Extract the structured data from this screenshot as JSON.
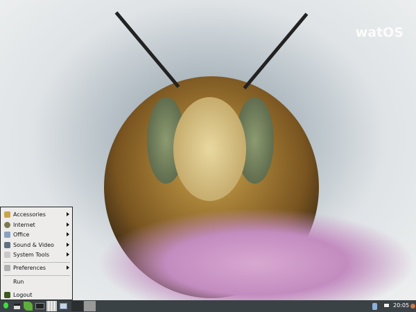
{
  "desktop": {
    "watermark": "watOS"
  },
  "menu": {
    "items": [
      {
        "label": "Accessories",
        "submenu": true,
        "icon": "accessories-icon"
      },
      {
        "label": "Internet",
        "submenu": true,
        "icon": "internet-icon"
      },
      {
        "label": "Office",
        "submenu": true,
        "icon": "office-icon"
      },
      {
        "label": "Sound & Video",
        "submenu": true,
        "icon": "sound-video-icon"
      },
      {
        "label": "System Tools",
        "submenu": true,
        "icon": "system-tools-icon"
      },
      {
        "label": "Preferences",
        "submenu": true,
        "icon": "preferences-icon"
      },
      {
        "label": "Run",
        "submenu": false
      },
      {
        "label": "Logout",
        "submenu": false,
        "icon": "logout-icon"
      }
    ]
  },
  "taskbar": {
    "clock": "20:05"
  }
}
